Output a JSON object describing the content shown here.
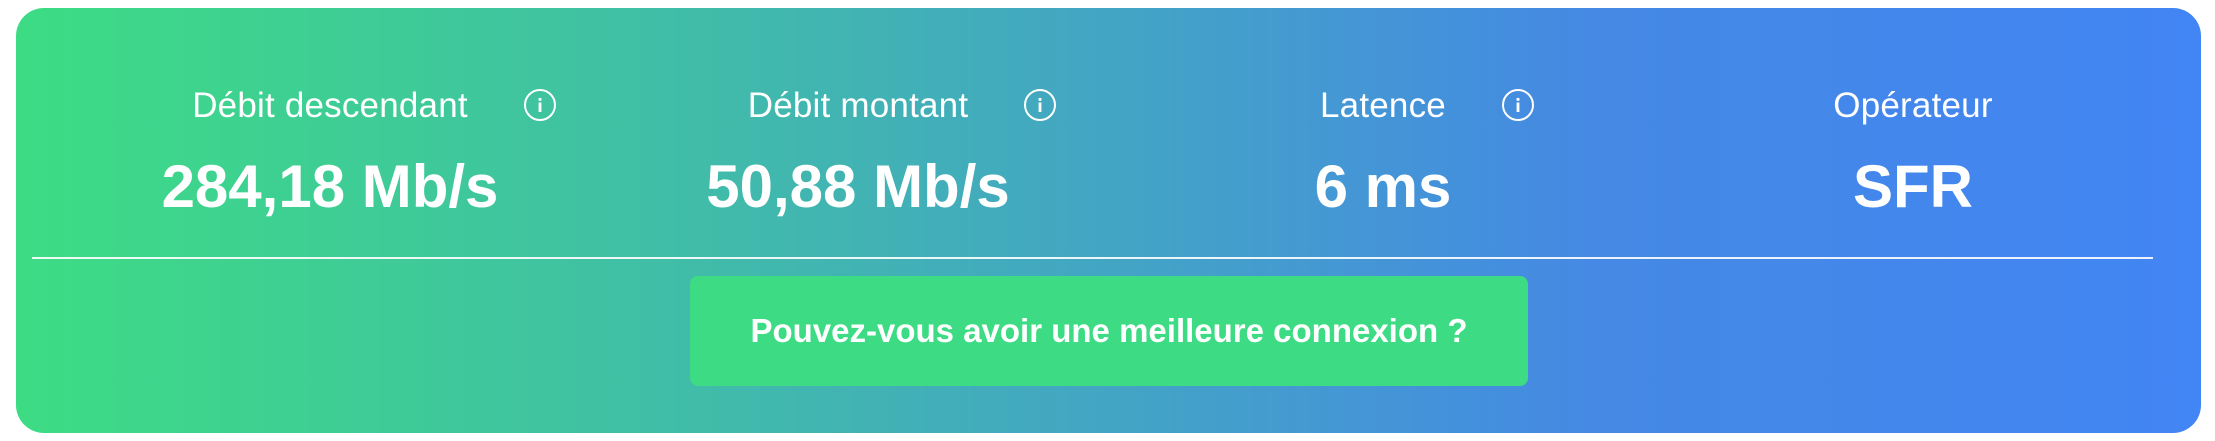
{
  "stats": [
    {
      "label": "Débit descendant",
      "value": "284,18 Mb/s",
      "has_info": true
    },
    {
      "label": "Débit montant",
      "value": "50,88 Mb/s",
      "has_info": true
    },
    {
      "label": "Latence",
      "value": "6 ms",
      "has_info": true
    },
    {
      "label": "Opérateur",
      "value": "SFR",
      "has_info": false
    }
  ],
  "icons": {
    "info": "info-icon"
  },
  "cta": {
    "label": "Pouvez-vous avoir une meilleure connexion ?"
  },
  "colors": {
    "gradient_start": "#3ddc84",
    "gradient_end": "#4285f4",
    "button": "#3ddc84",
    "text": "#ffffff"
  }
}
